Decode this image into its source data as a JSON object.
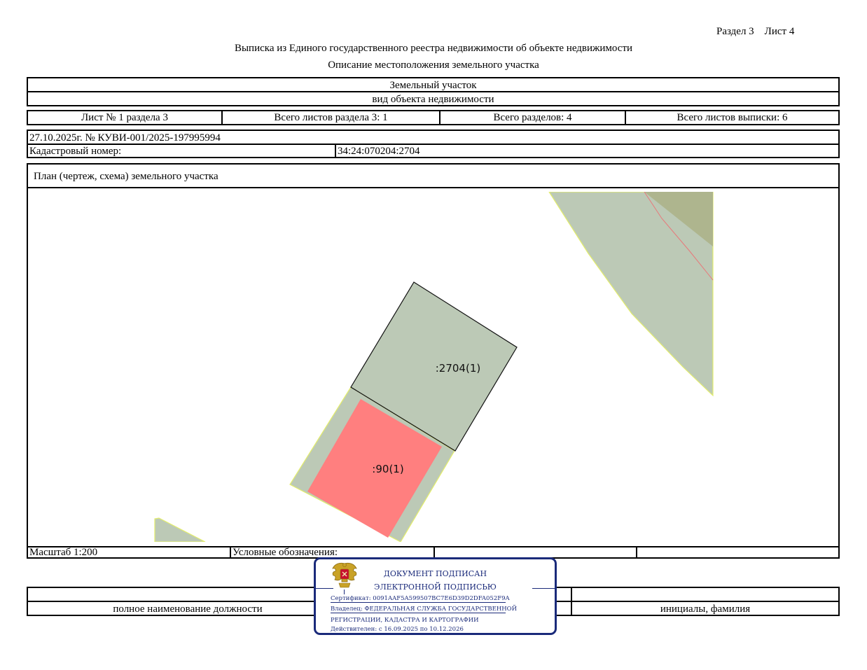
{
  "header": {
    "section_sheet": "Раздел 3    Лист 4",
    "title": "Выписка из Единого государственного реестра недвижимости об объекте недвижимости",
    "subtitle": "Описание местоположения земельного участка"
  },
  "object": {
    "type_value": "Земельный участок",
    "type_caption": "вид объекта недвижимости"
  },
  "sheets_row": {
    "sheet": "Лист № 1 раздела 3",
    "total_sheets_section": "Всего листов раздела 3: 1",
    "total_sections": "Всего разделов: 4",
    "total_sheets_extract": "Всего листов выписки: 6"
  },
  "doc": {
    "date_number": "27.10.2025г. № КУВИ-001/2025-197995994",
    "cadastral_label": "Кадастровый номер:",
    "cadastral_value": "34:24:070204:2704"
  },
  "plan": {
    "title": "План (чертеж, схема) земельного участка",
    "labels": {
      "parcel_main": ":2704(1)",
      "parcel_90": ":90(1)"
    },
    "colors": {
      "parcel_fill": "#bcc9b6",
      "highlight_fill": "#ff7f7f",
      "dark_parcel_fill": "#aeb58e",
      "boundary_yellow": "#e4ee6c",
      "boundary_red": "#e8787a"
    }
  },
  "legend_row": {
    "scale": "Масштаб 1:200",
    "legend_label": "Условные обозначения:"
  },
  "signature_row": {
    "position_caption": "полное наименование должности",
    "name_caption": "инициалы, фамилия"
  },
  "stamp": {
    "emblem": "coat-of-arms-icon",
    "line1": "ДОКУМЕНТ ПОДПИСАН",
    "line2": "ЭЛЕКТРОННОЙ ПОДПИСЬЮ",
    "certificate": "Сертификат: 0091AAF5A599507BC7E6D39D2DFA052F9A",
    "owner1": "Владелец: ФЕДЕРАЛЬНАЯ СЛУЖБА ГОСУДАРСТВЕННОЙ",
    "owner2": "РЕГИСТРАЦИИ, КАДАСТРА И КАРТОГРАФИИ",
    "valid": "Действителен: с 16.09.2025 по 10.12.2026"
  }
}
